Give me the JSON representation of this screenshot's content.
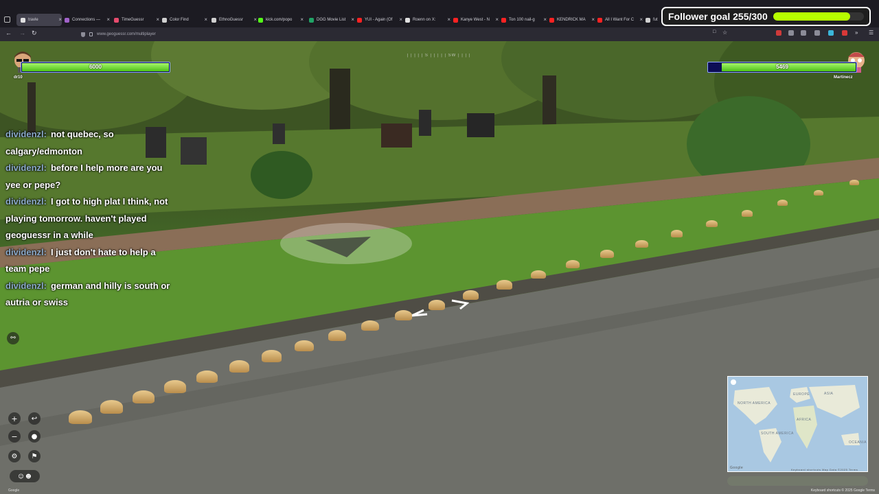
{
  "browser": {
    "tabs": [
      {
        "label": "travle",
        "color": "#e0e0e0"
      },
      {
        "label": "Connections —",
        "color": "#a062c9"
      },
      {
        "label": "TimeGuessr",
        "color": "#e64b6d"
      },
      {
        "label": "Color Find",
        "color": "#d0d0d0"
      },
      {
        "label": "EthnoGuessr",
        "color": "#d0d0d0"
      },
      {
        "label": "kick.com/popo",
        "color": "#53fc18"
      },
      {
        "label": "DGG Movie List",
        "color": "#21a366"
      },
      {
        "label": "YUI - Again (Of",
        "color": "#ff2222"
      },
      {
        "label": "Roenn on X:",
        "color": "#e0e0e0"
      },
      {
        "label": "Kanye West - N",
        "color": "#ff2222"
      },
      {
        "label": "Ton 100 nail-g",
        "color": "#ff2222"
      },
      {
        "label": "KENDRICK MA",
        "color": "#ff2222"
      },
      {
        "label": "All I Want For C",
        "color": "#ff2222"
      },
      {
        "label": "fut",
        "color": "#d0d0d0"
      }
    ],
    "url": "www.geoguessr.com/multiplayer",
    "icons": [
      "back-icon",
      "forward-icon",
      "reload-icon",
      "shield-icon",
      "lock-icon",
      "reader-icon",
      "star-icon"
    ]
  },
  "follower_goal": {
    "label": "Follower goal 255/300",
    "progress": 0.85,
    "color": "#b7ff00"
  },
  "players": {
    "left": {
      "name": "dr10",
      "health": "6000",
      "health_fraction": 1.0
    },
    "right": {
      "name": "Martinecz",
      "health": "5469",
      "health_fraction": 0.91
    }
  },
  "compass_text": "| | | | | S | | | | | SW | | | |",
  "chat": [
    {
      "user": "dividenzl:",
      "text": "not quebec, so calgary/edmonton"
    },
    {
      "user": "dividenzl:",
      "text": "before I help more are you yee or pepe?"
    },
    {
      "user": "dividenzl:",
      "text": "I got to high plat I think, not playing tomorrow. haven't played geoguessr in a while"
    },
    {
      "user": "dividenzl:",
      "text": "I just don't hate to help a team pepe"
    },
    {
      "user": "dividenzl:",
      "text": "german and hilly is south or autria or swiss"
    }
  ],
  "map": {
    "labels": [
      "NORTH AMERICA",
      "EUROPE",
      "ASIA",
      "AFRICA",
      "SOUTH AMERICA",
      "OCEANIA"
    ],
    "footer_left": "Google",
    "footer_right": "Keyboard shortcuts   Map Data ©2025   Terms"
  },
  "bottom_footer": "Keyboard shortcuts  © 2025 Google  Terms",
  "google_logo": "Google",
  "colors": {
    "accent": "#4ec216",
    "hp_border": "#8da2ff",
    "chat_user": "#8aa9c9"
  }
}
